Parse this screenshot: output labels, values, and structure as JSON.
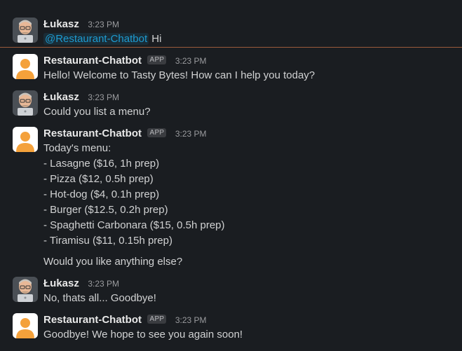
{
  "messages": [
    {
      "sender": "Łukasz",
      "time": "3:23 PM",
      "mention": "@Restaurant-Chatbot",
      "text": " Hi"
    },
    {
      "sender": "Restaurant-Chatbot",
      "badge": "APP",
      "time": "3:23 PM",
      "text": "Hello! Welcome to Tasty Bytes! How can I help you today?"
    },
    {
      "sender": "Łukasz",
      "time": "3:23 PM",
      "text": "Could you list a menu?"
    },
    {
      "sender": "Restaurant-Chatbot",
      "badge": "APP",
      "time": "3:23 PM",
      "lines": [
        "Today's menu:",
        "- Lasagne ($16, 1h prep)",
        "- Pizza ($12, 0.5h prep)",
        "- Hot-dog ($4, 0.1h prep)",
        "- Burger ($12.5, 0.2h prep)",
        "- Spaghetti Carbonara ($15, 0.5h prep)",
        "- Tiramisu ($11, 0.15h prep)"
      ],
      "followup": "Would you like anything else?"
    },
    {
      "sender": "Łukasz",
      "time": "3:23 PM",
      "text": "No, thats all... Goodbye!"
    },
    {
      "sender": "Restaurant-Chatbot",
      "badge": "APP",
      "time": "3:23 PM",
      "text": "Goodbye! We hope to see you again soon!"
    }
  ],
  "colors": {
    "background": "#1a1d21",
    "mention": "#1d9bd1",
    "new_divider": "#9c5a3c",
    "bot_avatar": "#f4a13b"
  },
  "icons": {
    "user_avatar": "memoji-avatar-icon",
    "bot_avatar": "default-user-avatar-icon"
  }
}
